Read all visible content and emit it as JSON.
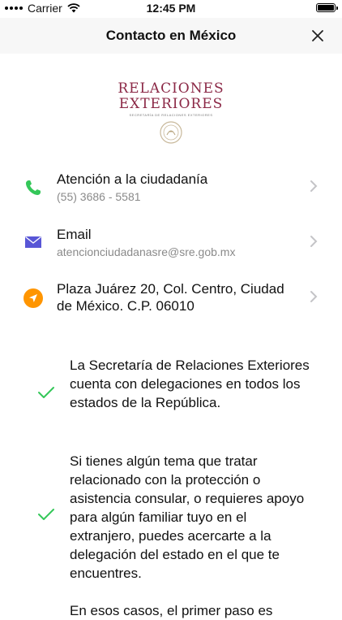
{
  "status": {
    "carrier": "Carrier",
    "time": "12:45 PM"
  },
  "nav": {
    "title": "Contacto en México"
  },
  "logo": {
    "line1": "RELACIONES",
    "line2": "EXTERIORES",
    "subtitle": "SECRETARÍA DE RELACIONES EXTERIORES"
  },
  "contacts": [
    {
      "title": "Atención a la ciudadanía",
      "subtitle": "(55) 3686 - 5581",
      "icon": "phone-icon",
      "color": "#34c759"
    },
    {
      "title": "Email",
      "subtitle": "atencionciudadanasre@sre.gob.mx",
      "icon": "envelope-icon",
      "color": "#5856d6"
    },
    {
      "title": "Plaza Juárez 20, Col. Centro, Ciudad de México. C.P. 06010",
      "icon": "location-arrow-icon",
      "color": "#ff9500"
    }
  ],
  "info": [
    "La Secretaría de Relaciones Exteriores cuenta con delegaciones en todos los estados de la República.",
    "Si tienes algún tema que tratar relacionado con la protección o asistencia consular, o requieres apoyo para algún familiar tuyo en el extranjero, puedes acercarte a la delegación del estado en el que te encuentres.",
    "En esos casos, el primer paso es"
  ]
}
